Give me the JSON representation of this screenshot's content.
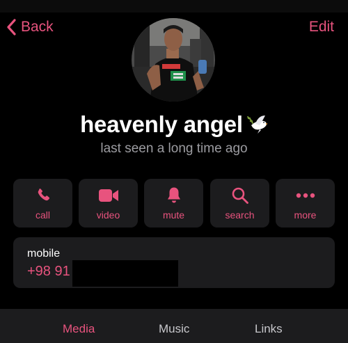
{
  "nav": {
    "back_label": "Back",
    "edit_label": "Edit"
  },
  "profile": {
    "name": "heavenly angel",
    "name_emoji": "dove-emoji",
    "status": "last seen a long time ago",
    "avatar": "profile-photo"
  },
  "actions": [
    {
      "id": "call",
      "label": "call",
      "icon": "phone-icon"
    },
    {
      "id": "video",
      "label": "video",
      "icon": "video-camera-icon"
    },
    {
      "id": "mute",
      "label": "mute",
      "icon": "bell-icon"
    },
    {
      "id": "search",
      "label": "search",
      "icon": "magnifier-icon"
    },
    {
      "id": "more",
      "label": "more",
      "icon": "more-dots-icon"
    }
  ],
  "contact": {
    "label": "mobile",
    "phone_visible": "+98 91"
  },
  "tabs": [
    {
      "label": "Media",
      "active": true
    },
    {
      "label": "Music",
      "active": false
    },
    {
      "label": "Links",
      "active": false
    }
  ],
  "colors": {
    "accent": "#e8537e",
    "background": "#000000",
    "card": "#1c1c1e",
    "secondary_text": "#9c9ca1"
  }
}
